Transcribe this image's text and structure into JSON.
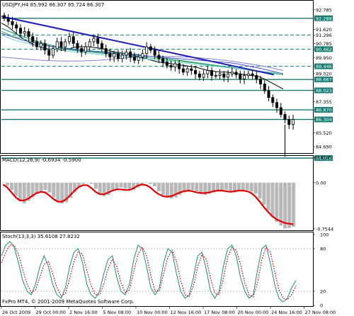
{
  "chart_data": [
    {
      "type": "line",
      "panel": "price",
      "header": "USDJPY,H4  85.992 86.307 85.724 86.307",
      "symbol": "USDJPY",
      "timeframe": "H4",
      "ohlc": {
        "open": 85.992,
        "high": 86.307,
        "low": 85.724,
        "close": 86.307
      },
      "ylim": [
        84.4,
        93.2
      ],
      "y_ticks": [
        "92.785",
        "92.288",
        "91.620",
        "91.296",
        "90.785",
        "90.462",
        "89.950",
        "89.446",
        "89.020",
        "88.667",
        "88.023",
        "87.355",
        "86.870",
        "86.304",
        "85.520",
        "84.690",
        "84.018"
      ],
      "highlighted_levels": [
        92.288,
        90.462,
        89.446,
        88.667,
        88.023,
        86.87,
        86.304,
        84.018
      ],
      "solid_levels": [
        92.288,
        88.667,
        88.023,
        86.87,
        86.304,
        84.018
      ],
      "dashed_levels": [
        91.296,
        90.462,
        89.446
      ],
      "trendline": {
        "from": [
          0,
          92.4
        ],
        "to": [
          60,
          88.95
        ],
        "color": "#1c1cb8"
      },
      "candles_close": [
        92.3,
        92.1,
        91.9,
        91.7,
        91.4,
        91.5,
        91.2,
        90.9,
        90.6,
        90.8,
        90.4,
        90.1,
        90.5,
        90.9,
        90.6,
        90.9,
        91.2,
        90.8,
        90.5,
        90.3,
        90.6,
        90.9,
        91.1,
        90.8,
        90.5,
        90.2,
        90.0,
        90.2,
        89.9,
        90.1,
        90.3,
        90.0,
        89.8,
        90.0,
        90.2,
        90.6,
        90.4,
        90.1,
        89.9,
        89.7,
        89.5,
        89.4,
        89.6,
        89.3,
        89.1,
        89.3,
        89.2,
        89.0,
        88.8,
        89.0,
        89.2,
        88.9,
        88.9,
        89.0,
        88.8,
        89.0,
        89.1,
        88.95,
        88.7,
        88.9,
        89.0,
        88.9,
        88.7,
        88.4,
        88.0,
        87.6,
        87.3,
        87.0,
        86.6,
        86.3,
        86.0,
        86.3
      ],
      "series": [
        {
          "color": "#000000",
          "values": [
            92.0,
            91.8,
            91.5,
            91.2,
            90.95,
            90.75,
            90.6,
            90.5,
            90.45,
            90.4,
            90.4,
            90.5,
            90.6,
            90.6,
            90.6,
            90.55,
            90.5,
            90.4,
            90.3,
            90.25,
            90.2,
            90.1,
            90.0,
            89.9,
            89.8,
            89.7,
            89.65,
            89.6,
            89.55,
            89.5,
            89.45,
            89.4,
            89.3,
            89.2,
            89.15,
            89.1,
            89.1,
            89.05,
            89.0,
            88.95,
            88.9,
            88.85,
            88.7,
            88.5,
            88.3,
            88.1
          ]
        },
        {
          "color": "#0c8a7c",
          "values": [
            91.7,
            91.4,
            91.15,
            90.9,
            90.7,
            90.55,
            90.45,
            90.38,
            90.32,
            90.28,
            90.22,
            90.15,
            90.05,
            89.95,
            89.85,
            89.75,
            89.65,
            89.55,
            89.45,
            89.35,
            89.25,
            89.15,
            89.05,
            88.95
          ]
        },
        {
          "color": "#2fb85a",
          "values": [
            91.5,
            91.2,
            91.0,
            90.8,
            90.6,
            90.45,
            90.35,
            90.28,
            90.2,
            90.12,
            90.05,
            89.98,
            89.9,
            89.82,
            89.74,
            89.65,
            89.55,
            89.45,
            89.35,
            89.25,
            89.15,
            89.05,
            88.95
          ]
        },
        {
          "color": "#7ad0d8",
          "values": [
            91.3,
            91.0,
            90.8,
            90.6,
            90.45,
            90.35,
            90.28,
            90.2,
            90.12,
            90.05,
            89.98,
            89.9,
            89.82,
            89.74,
            89.66,
            89.58,
            89.5,
            89.42,
            89.34,
            89.26,
            89.18,
            89.1,
            89.02
          ]
        },
        {
          "color": "#5050c8",
          "values": [
            91.4,
            91.2,
            91.0,
            90.85,
            90.7,
            90.6,
            90.5,
            90.42,
            90.36,
            90.3,
            90.25,
            90.2,
            90.15,
            90.1,
            90.05,
            90.0,
            89.95,
            89.9,
            89.85,
            89.8,
            89.75,
            89.7,
            89.65,
            89.55,
            89.42,
            89.3,
            89.15,
            89.0
          ]
        },
        {
          "color": "#8080d8",
          "values": [
            90.0,
            89.95,
            89.9,
            89.85,
            89.8,
            89.78,
            89.76,
            89.75,
            89.76,
            89.78,
            89.8,
            89.85,
            89.9,
            89.95,
            90.0,
            90.02,
            90.03,
            90.03,
            90.02,
            90.0,
            89.96,
            89.92,
            89.86,
            89.8,
            89.72,
            89.64,
            89.55,
            89.45,
            89.33,
            89.2
          ]
        }
      ]
    },
    {
      "type": "bar",
      "panel": "macd",
      "header": "MACD(12,26,9) -0.6934 -0.5900",
      "name": "MACD",
      "params": "12,26,9",
      "macd_value": -0.6934,
      "signal_value": -0.59,
      "ylim": [
        -0.7544,
        0.4145
      ],
      "y_ticks": [
        "0.4145",
        "0.00",
        "-0.7544"
      ],
      "histogram": [
        0.0,
        -0.05,
        -0.12,
        -0.22,
        -0.3,
        -0.34,
        -0.3,
        -0.24,
        -0.18,
        -0.14,
        -0.12,
        -0.16,
        -0.24,
        -0.3,
        -0.34,
        -0.32,
        -0.25,
        -0.16,
        -0.08,
        -0.02,
        0.0,
        -0.02,
        -0.1,
        -0.18,
        -0.22,
        -0.2,
        -0.14,
        -0.1,
        -0.08,
        -0.1,
        -0.12,
        -0.12,
        -0.08,
        -0.02,
        0.0,
        -0.02,
        -0.06,
        -0.14,
        -0.2,
        -0.24,
        -0.26,
        -0.24,
        -0.2,
        -0.16,
        -0.14,
        -0.12,
        -0.14,
        -0.18,
        -0.2,
        -0.18,
        -0.16,
        -0.14,
        -0.12,
        -0.12,
        -0.14,
        -0.16,
        -0.14,
        -0.12,
        -0.12,
        -0.14,
        -0.18,
        -0.26,
        -0.36,
        -0.46,
        -0.56,
        -0.64,
        -0.7,
        -0.75,
        -0.74,
        -0.72
      ],
      "signal": [
        -0.03,
        -0.08,
        -0.16,
        -0.24,
        -0.29,
        -0.29,
        -0.26,
        -0.21,
        -0.17,
        -0.15,
        -0.16,
        -0.21,
        -0.27,
        -0.31,
        -0.31,
        -0.27,
        -0.2,
        -0.13,
        -0.07,
        -0.04,
        -0.04,
        -0.09,
        -0.15,
        -0.19,
        -0.19,
        -0.16,
        -0.13,
        -0.11,
        -0.11,
        -0.12,
        -0.12,
        -0.09,
        -0.05,
        -0.03,
        -0.04,
        -0.08,
        -0.14,
        -0.19,
        -0.22,
        -0.23,
        -0.22,
        -0.19,
        -0.16,
        -0.14,
        -0.13,
        -0.14,
        -0.16,
        -0.17,
        -0.17,
        -0.16,
        -0.14,
        -0.13,
        -0.13,
        -0.14,
        -0.15,
        -0.14,
        -0.13,
        -0.13,
        -0.14,
        -0.17,
        -0.23,
        -0.31,
        -0.4,
        -0.48,
        -0.55,
        -0.6,
        -0.63,
        -0.66,
        -0.67,
        -0.68
      ]
    },
    {
      "type": "line",
      "panel": "stochastic",
      "header": "Stoch(13,3,3) 35.6108 27.8232",
      "name": "Stoch",
      "params": "13,3,3",
      "main_value": 35.6108,
      "signal_value": 27.8232,
      "ylim": [
        0,
        100
      ],
      "y_ticks": [
        "100",
        "80",
        "20",
        "0"
      ],
      "main": [
        70,
        85,
        90,
        82,
        60,
        35,
        20,
        15,
        30,
        55,
        70,
        55,
        30,
        15,
        10,
        25,
        55,
        75,
        80,
        60,
        30,
        15,
        10,
        20,
        45,
        65,
        70,
        40,
        20,
        15,
        30,
        65,
        85,
        80,
        55,
        25,
        15,
        25,
        60,
        80,
        75,
        45,
        20,
        10,
        15,
        40,
        70,
        75,
        50,
        20,
        10,
        20,
        55,
        80,
        85,
        70,
        40,
        20,
        10,
        15,
        50,
        80,
        85,
        60,
        30,
        10,
        5,
        10,
        25,
        35
      ],
      "signal": [
        60,
        75,
        85,
        85,
        72,
        50,
        30,
        18,
        22,
        40,
        58,
        62,
        45,
        25,
        13,
        17,
        38,
        62,
        76,
        72,
        50,
        28,
        15,
        15,
        30,
        52,
        65,
        55,
        32,
        18,
        22,
        48,
        72,
        82,
        70,
        42,
        20,
        20,
        45,
        68,
        78,
        62,
        35,
        15,
        12,
        28,
        55,
        72,
        65,
        38,
        17,
        15,
        38,
        68,
        82,
        78,
        58,
        32,
        15,
        12,
        32,
        65,
        82,
        75,
        48,
        22,
        10,
        8,
        15,
        28
      ]
    }
  ],
  "x_axis": {
    "tick_labels": [
      "26 Oct 2009",
      "29 Oct 00:00",
      "2 Nov 16:00",
      "5 Nov 08:00",
      "10 Nov 00:00",
      "12 Nov 16:00",
      "17 Nov 08:00",
      "20 Nov 00:00",
      "24 Nov 16:00",
      "27 Nov 08:00"
    ]
  },
  "watermark": "FxPro MT4, © 2001-2009 MetaQuotes Software Corp.",
  "colors": {
    "background": "#ffffff",
    "level_highlight": "#1a7a72",
    "candle_up": "#ffffff",
    "candle_down": "#000000",
    "trendline": "#1c1cb8",
    "macd_hist": "#b8b8b8",
    "macd_signal": "#e00000",
    "stoch_main": "#1a8c80",
    "stoch_signal": "#e00000"
  }
}
